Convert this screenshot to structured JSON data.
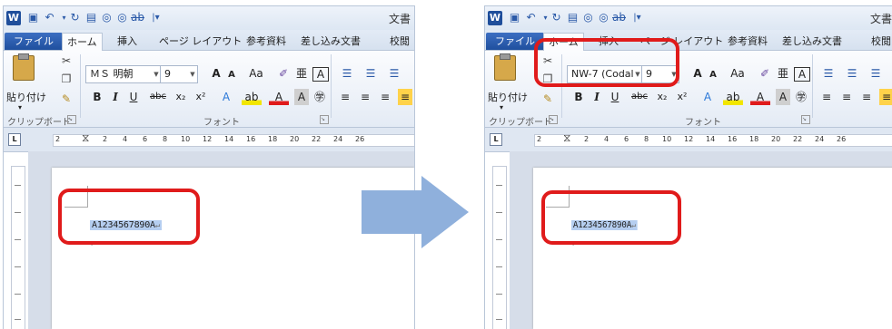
{
  "qat": {
    "doc_title": "文書"
  },
  "tabs": [
    "ファイル",
    "ホーム",
    "挿入",
    "ページ レイアウト",
    "参考資料",
    "差し込み文書",
    "校閲"
  ],
  "ribbon": {
    "paste_label": "貼り付け",
    "clipboard_group": "クリップボード",
    "font_group": "フォント",
    "grow_font": "A",
    "shrink_font": "A",
    "change_case": "Aa",
    "bold": "B",
    "italic": "I",
    "underline": "U",
    "strike": "abc",
    "subscript": "x₂",
    "superscript": "x²"
  },
  "left_panel": {
    "font_name": "ＭＳ 明朝",
    "font_size": "9",
    "selected_text": "A1234567890A"
  },
  "right_panel": {
    "font_name": "NW-7 (Codal",
    "font_size": "9",
    "selected_text": "A1234567890A"
  },
  "ruler_ticks": [
    "2",
    "2",
    "4",
    "6",
    "8",
    "10",
    "12",
    "14",
    "16",
    "18",
    "20",
    "22",
    "24",
    "26"
  ],
  "colors": {
    "highlight": "#e01b1b",
    "selection": "#b5cef0",
    "arrow": "#8fb0dc",
    "file_tab": "#2a5bab"
  },
  "icons": {
    "word_logo": "word-icon",
    "save": "save-icon",
    "undo": "undo-icon",
    "redo": "redo-icon",
    "print_preview": "print-preview-icon",
    "cut": "scissors-icon",
    "copy": "copy-icon",
    "format_painter": "brush-icon",
    "transition": "arrow-right-icon"
  }
}
